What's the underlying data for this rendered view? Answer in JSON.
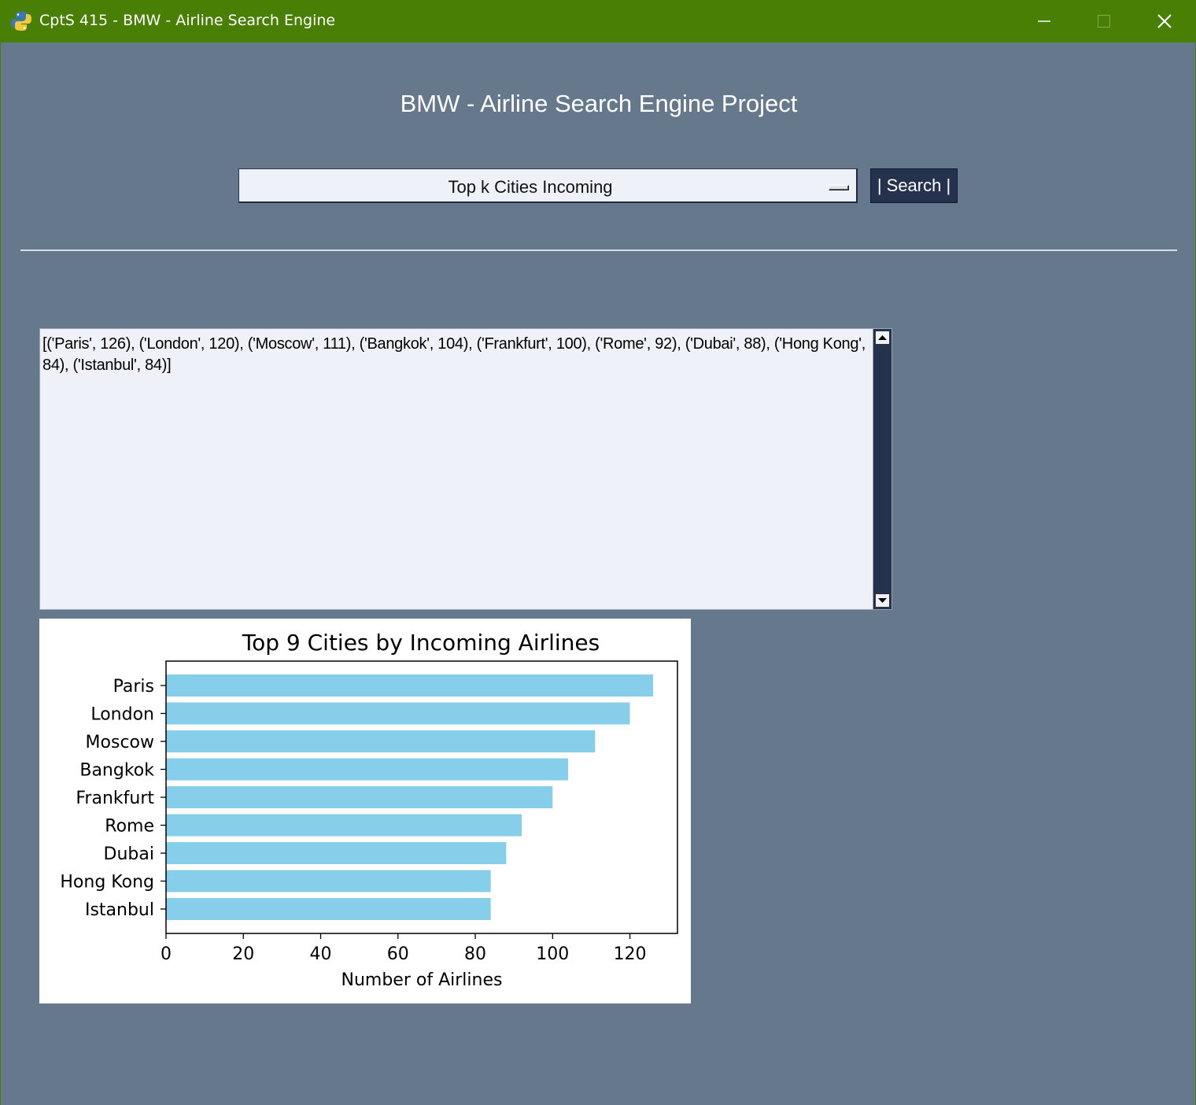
{
  "window": {
    "title": "CptS 415 - BMW - Airline Search Engine",
    "controls": [
      "minimize",
      "maximize",
      "close"
    ]
  },
  "header": {
    "title": "BMW - Airline Search Engine Project"
  },
  "query": {
    "selected_option": "Top k Cities Incoming",
    "search_label": "| Search |"
  },
  "results": {
    "text": "[('Paris', 126), ('London', 120), ('Moscow', 111), ('Bangkok', 104), ('Frankfurt', 100), ('Rome', 92), ('Dubai', 88), ('Hong Kong', 84), ('Istanbul', 84)]"
  },
  "colors": {
    "titlebar": "#4a7f06",
    "background": "#66788c",
    "bar": "#87ceeb",
    "button": "#25324e"
  },
  "chart_data": {
    "type": "bar",
    "orientation": "horizontal",
    "title": "Top 9 Cities by Incoming Airlines",
    "xlabel": "Number of Airlines",
    "ylabel": "",
    "categories": [
      "Paris",
      "London",
      "Moscow",
      "Bangkok",
      "Frankfurt",
      "Rome",
      "Dubai",
      "Hong Kong",
      "Istanbul"
    ],
    "values": [
      126,
      120,
      111,
      104,
      100,
      92,
      88,
      84,
      84
    ],
    "xticks": [
      0,
      20,
      40,
      60,
      80,
      100,
      120
    ],
    "xlim": [
      0,
      132.3
    ],
    "grid": false,
    "bar_color": "#87ceeb"
  }
}
